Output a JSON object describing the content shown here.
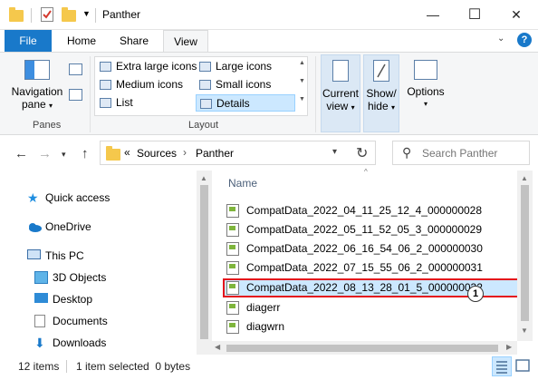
{
  "window": {
    "title": "Panther",
    "minimize_glyph": "—",
    "maximize_glyph": "☐",
    "close_glyph": "✕"
  },
  "ribbon_tabs": [
    "File",
    "Home",
    "Share",
    "View"
  ],
  "ribbon": {
    "panes": {
      "navigation_pane_line1": "Navigation",
      "navigation_pane_line2": "pane",
      "group_label": "Panes"
    },
    "layout": {
      "options": [
        "Extra large icons",
        "Large icons",
        "Medium icons",
        "Small icons",
        "List",
        "Details"
      ],
      "selected": "Details",
      "group_label": "Layout"
    },
    "current_view_line1": "Current",
    "current_view_line2": "view",
    "show_hide_line1": "Show/",
    "show_hide_line2": "hide",
    "options_label": "Options"
  },
  "address": {
    "prefix": "«",
    "path": [
      "Sources",
      "Panther"
    ],
    "separator": "›"
  },
  "search": {
    "placeholder": "Search Panther"
  },
  "nav_pane": {
    "items": [
      "Quick access",
      "OneDrive",
      "This PC",
      "3D Objects",
      "Desktop",
      "Documents",
      "Downloads"
    ]
  },
  "file_list": {
    "column_name": "Name",
    "files": [
      "CompatData_2022_04_11_25_12_4_000000028",
      "CompatData_2022_05_11_52_05_3_000000029",
      "CompatData_2022_06_16_54_06_2_000000030",
      "CompatData_2022_07_15_55_06_2_000000031",
      "CompatData_2022_08_13_28_01_5_000000032",
      "diagerr",
      "diagwrn"
    ],
    "selected_index": 4,
    "callout_number": "1"
  },
  "status": {
    "item_count": "12 items",
    "selection": "1 item selected  0 bytes"
  },
  "colors": {
    "accent": "#1979ca",
    "selection": "#cce8ff",
    "highlight": "#e4141c"
  }
}
